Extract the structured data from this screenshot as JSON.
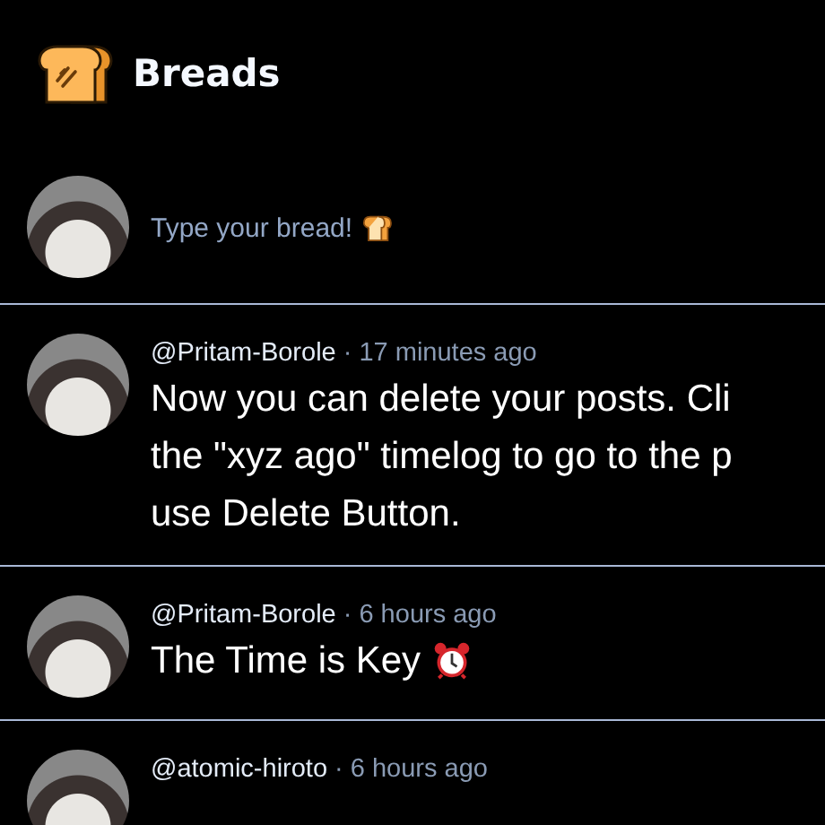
{
  "header": {
    "title": "Breads"
  },
  "composer": {
    "placeholder": "Type your bread!"
  },
  "posts": [
    {
      "handle": "@Pritam-Borole",
      "time": "· 17 minutes ago",
      "lines": [
        "Now you can delete your posts. Cli",
        "the \"xyz ago\" timelog to go to the p",
        "use Delete Button."
      ]
    },
    {
      "kind": "text-with-clock",
      "handle": "@Pritam-Borole",
      "time": "· 6 hours ago",
      "lines": [
        "The Time is Key"
      ]
    },
    {
      "handle": "@atomic-hiroto",
      "time": "· 6 hours ago"
    }
  ]
}
